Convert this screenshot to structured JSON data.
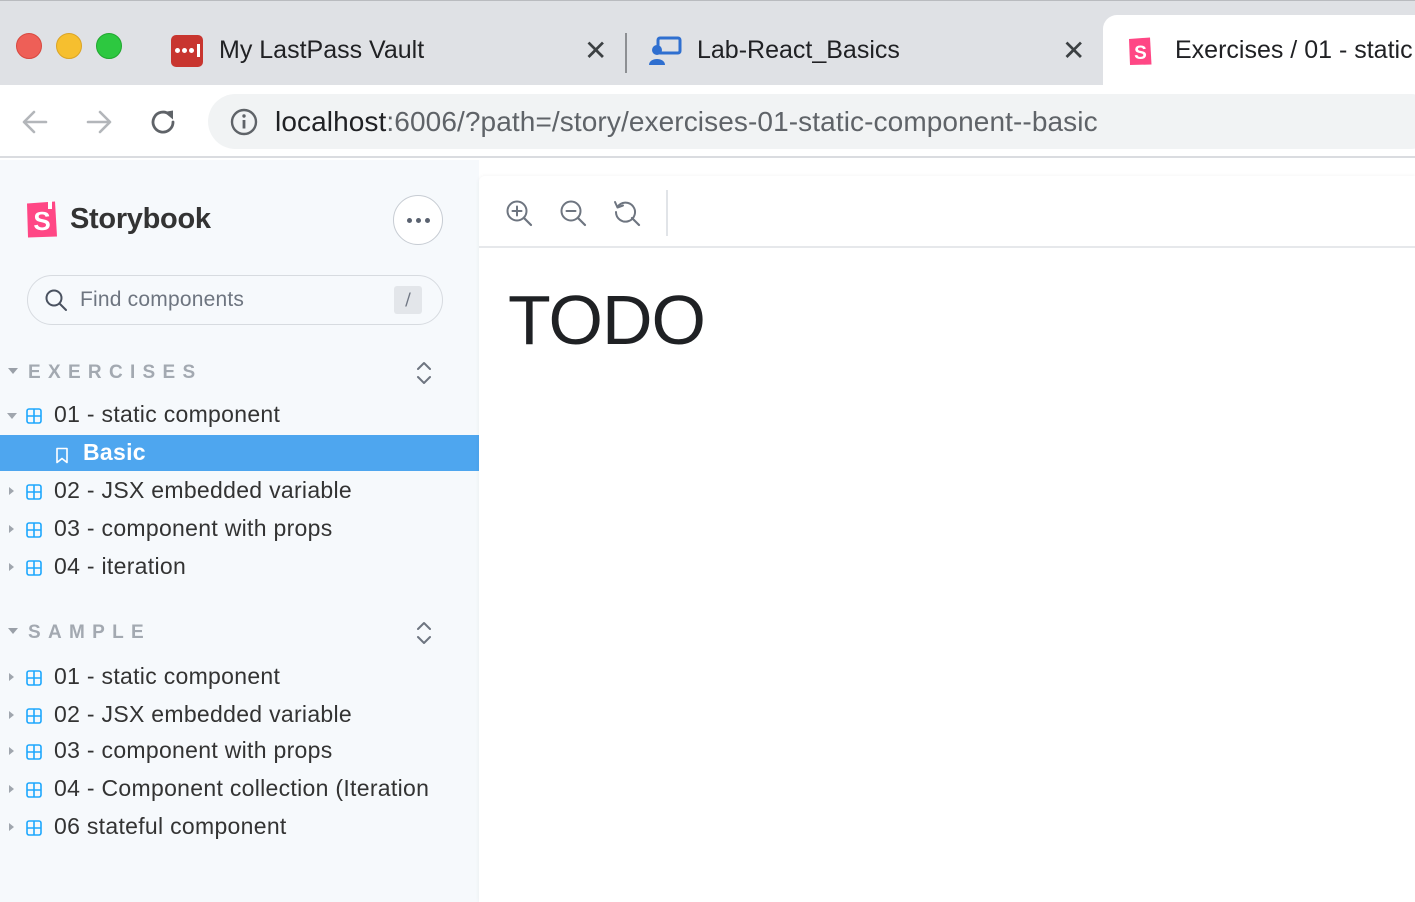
{
  "browser": {
    "tabs": [
      {
        "title": "My LastPass Vault",
        "favicon": "lastpass-icon"
      },
      {
        "title": "Lab-React_Basics",
        "favicon": "lab-icon"
      },
      {
        "title": "Exercises / 01 - static",
        "favicon": "storybook-icon",
        "active": true
      }
    ],
    "address": {
      "host": "localhost",
      "rest": ":6006/?path=/story/exercises-01-static-component--basic"
    }
  },
  "sidebar": {
    "brand": "Storybook",
    "search_placeholder": "Find components",
    "search_shortcut": "/",
    "groups": [
      {
        "label": "EXERCISES",
        "items": [
          {
            "label": "01 - static component",
            "expanded": true
          },
          {
            "label": "Basic",
            "selected": true
          },
          {
            "label": "02 - JSX embedded variable"
          },
          {
            "label": "03 - component with props"
          },
          {
            "label": "04 - iteration"
          }
        ]
      },
      {
        "label": "SAMPLE",
        "items": [
          {
            "label": "01 - static component"
          },
          {
            "label": "02 - JSX embedded variable"
          },
          {
            "label": "03 - component with props"
          },
          {
            "label": "04 - Component collection (Iteration"
          },
          {
            "label": "06 stateful component"
          }
        ]
      }
    ]
  },
  "preview": {
    "heading": "TODO",
    "toolbar": [
      "zoom-in-icon",
      "zoom-out-icon",
      "zoom-reset-icon"
    ]
  },
  "colors": {
    "accent": "#4ea6ef",
    "storybook_pink": "#ff4785",
    "component_icon": "#1ea7fd"
  }
}
